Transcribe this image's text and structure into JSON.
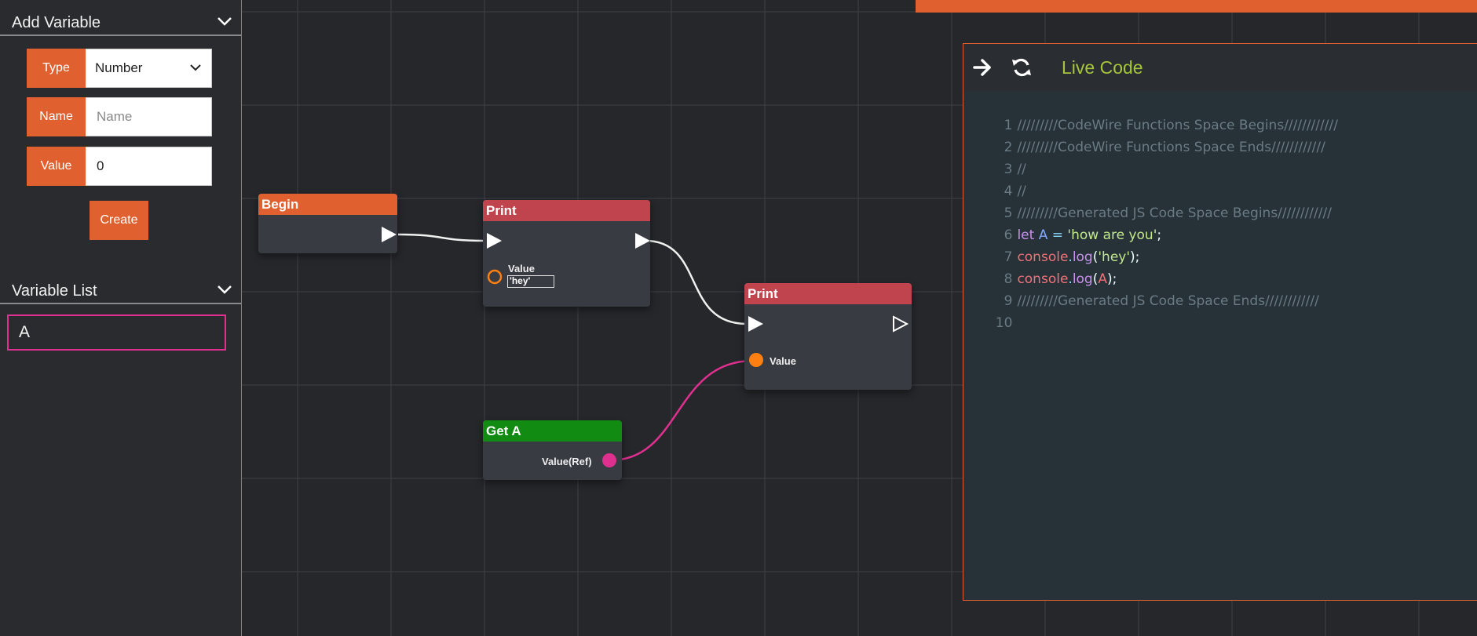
{
  "sidebar": {
    "add_variable": {
      "title": "Add Variable",
      "type_label": "Type",
      "type_value": "Number",
      "name_label": "Name",
      "name_placeholder": "Name",
      "value_label": "Value",
      "value_value": "0",
      "create_label": "Create"
    },
    "variable_list": {
      "title": "Variable List",
      "items": [
        "A"
      ]
    }
  },
  "nodes": {
    "begin": {
      "title": "Begin"
    },
    "print1": {
      "title": "Print",
      "value_label": "Value",
      "value_input": "'hey'"
    },
    "print2": {
      "title": "Print",
      "value_label": "Value"
    },
    "get_a": {
      "title": "Get A",
      "output_label": "Value(Ref)"
    }
  },
  "code_panel": {
    "title": "Live Code",
    "line_numbers": [
      "1",
      "2",
      "3",
      "4",
      "5",
      "6",
      "7",
      "8",
      "9",
      "10"
    ],
    "comment_lines": {
      "l1": "/////////CodeWire Functions Space Begins////////////",
      "l2": "/////////CodeWire Functions Space Ends////////////",
      "l3": "//",
      "l4": "//",
      "l5": "/////////Generated JS Code Space Begins////////////",
      "l9": "/////////Generated JS Code Space Ends////////////"
    },
    "line6": {
      "kw": "let",
      "var": "A",
      "op": "=",
      "str": "'how are you'",
      "end": ";"
    },
    "line7": {
      "obj": "console",
      "dot": ".",
      "fn": "log",
      "open": "(",
      "arg": "'hey'",
      "close": ");"
    },
    "line8": {
      "obj": "console",
      "dot": ".",
      "fn": "log",
      "open": "(",
      "arg": "A",
      "close": ");"
    }
  },
  "colors": {
    "accent": "#e0612f",
    "print_header": "#c0444d",
    "get_header": "#128b12",
    "ref_pin": "#e0308f",
    "value_pin": "#ff7f11",
    "live_code_title": "#a6c63a"
  }
}
